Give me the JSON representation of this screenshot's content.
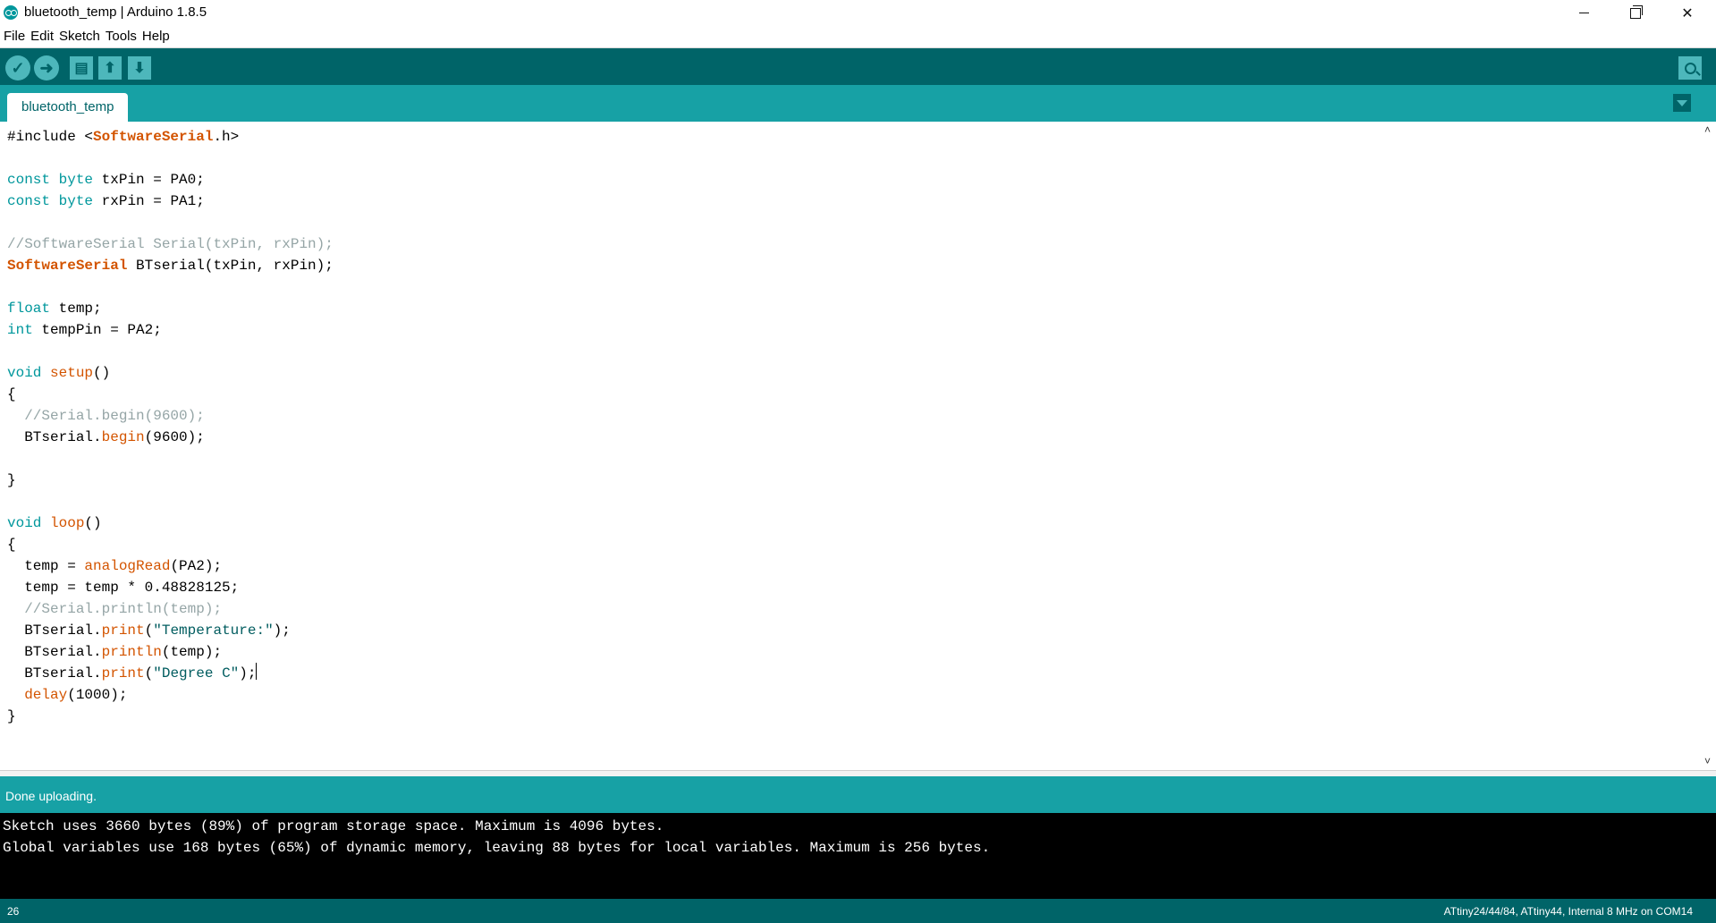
{
  "window": {
    "title": "bluetooth_temp | Arduino 1.8.5",
    "controls": {
      "minimize": "–",
      "maximize": "□",
      "close": "✕"
    }
  },
  "menu": [
    "File",
    "Edit",
    "Sketch",
    "Tools",
    "Help"
  ],
  "toolbar": {
    "verify_icon": "checkmark-icon",
    "upload_icon": "right-arrow-icon",
    "new_icon": "document-icon",
    "open_icon": "up-arrow-icon",
    "save_icon": "down-arrow-icon",
    "serial_monitor_icon": "magnifier-icon"
  },
  "tabs": [
    {
      "label": "bluetooth_temp",
      "active": true
    }
  ],
  "editor": {
    "lines": [
      [
        {
          "t": "#include <"
        },
        {
          "t": "SoftwareSerial",
          "c": "kwb"
        },
        {
          "t": ".h>"
        }
      ],
      [],
      [
        {
          "t": "const",
          "c": "kw"
        },
        {
          "t": " "
        },
        {
          "t": "byte",
          "c": "kw"
        },
        {
          "t": " txPin = PA0;"
        }
      ],
      [
        {
          "t": "const",
          "c": "kw"
        },
        {
          "t": " "
        },
        {
          "t": "byte",
          "c": "kw"
        },
        {
          "t": " rxPin = PA1;"
        }
      ],
      [],
      [
        {
          "t": "//SoftwareSerial Serial(txPin, rxPin);",
          "c": "cm"
        }
      ],
      [
        {
          "t": "SoftwareSerial",
          "c": "kwb"
        },
        {
          "t": " BTserial(txPin, rxPin);"
        }
      ],
      [],
      [
        {
          "t": "float",
          "c": "kw"
        },
        {
          "t": " temp;"
        }
      ],
      [
        {
          "t": "int",
          "c": "kw"
        },
        {
          "t": " tempPin = PA2;"
        }
      ],
      [],
      [
        {
          "t": "void",
          "c": "kw"
        },
        {
          "t": " "
        },
        {
          "t": "setup",
          "c": "kw2"
        },
        {
          "t": "()"
        }
      ],
      [
        {
          "t": "{"
        }
      ],
      [
        {
          "t": "  //Serial.begin(9600);",
          "c": "cm"
        }
      ],
      [
        {
          "t": "  BTserial."
        },
        {
          "t": "begin",
          "c": "kw2"
        },
        {
          "t": "(9600);"
        }
      ],
      [],
      [
        {
          "t": "}"
        }
      ],
      [],
      [
        {
          "t": "void",
          "c": "kw"
        },
        {
          "t": " "
        },
        {
          "t": "loop",
          "c": "kw2"
        },
        {
          "t": "()"
        }
      ],
      [
        {
          "t": "{"
        }
      ],
      [
        {
          "t": "  temp = "
        },
        {
          "t": "analogRead",
          "c": "kw2"
        },
        {
          "t": "(PA2);"
        }
      ],
      [
        {
          "t": "  temp = temp * 0.48828125;"
        }
      ],
      [
        {
          "t": "  //Serial.println(temp);",
          "c": "cm"
        }
      ],
      [
        {
          "t": "  BTserial."
        },
        {
          "t": "print",
          "c": "kw2"
        },
        {
          "t": "("
        },
        {
          "t": "\"Temperature:\"",
          "c": "st"
        },
        {
          "t": ");"
        }
      ],
      [
        {
          "t": "  BTserial."
        },
        {
          "t": "println",
          "c": "kw2"
        },
        {
          "t": "(temp);"
        }
      ],
      [
        {
          "t": "  BTserial."
        },
        {
          "t": "print",
          "c": "kw2"
        },
        {
          "t": "("
        },
        {
          "t": "\"Degree C\"",
          "c": "st"
        },
        {
          "t": ");"
        },
        {
          "caret": true
        }
      ],
      [
        {
          "t": "  "
        },
        {
          "t": "delay",
          "c": "kw2"
        },
        {
          "t": "(1000);"
        }
      ],
      [
        {
          "t": "}"
        }
      ]
    ]
  },
  "status": {
    "message": "Done uploading."
  },
  "console": {
    "lines": [
      "Sketch uses 3660 bytes (89%) of program storage space. Maximum is 4096 bytes.",
      "Global variables use 168 bytes (65%) of dynamic memory, leaving 88 bytes for local variables. Maximum is 256 bytes."
    ]
  },
  "footer": {
    "line_number": "26",
    "board": "ATtiny24/44/84, ATtiny44, Internal 8 MHz on COM14"
  },
  "colors": {
    "toolbar_bg": "#006468",
    "tabbar_bg": "#17a1a5",
    "keyword": "#00979c",
    "function": "#d35400",
    "comment": "#95a5a6"
  }
}
